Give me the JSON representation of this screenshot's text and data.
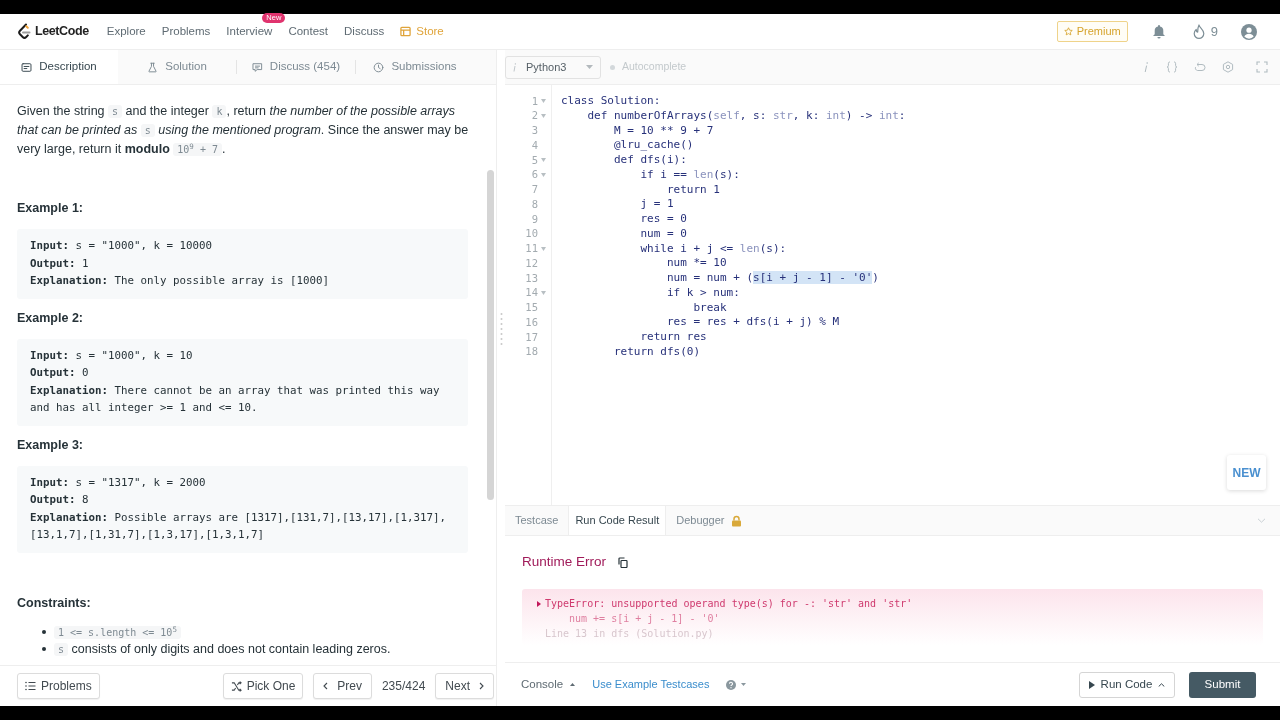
{
  "nav": {
    "logo": "LeetCode",
    "items": [
      {
        "label": "Explore",
        "kind": "link"
      },
      {
        "label": "Problems",
        "kind": "link"
      },
      {
        "label": "Interview",
        "kind": "link",
        "badge": "New"
      },
      {
        "label": "Contest",
        "kind": "link"
      },
      {
        "label": "Discuss",
        "kind": "link"
      },
      {
        "label": "Store",
        "kind": "store"
      }
    ],
    "premium": "Premium",
    "streak": "9"
  },
  "description_tabs": [
    {
      "label": "Description",
      "kind": "description",
      "selected": true
    },
    {
      "label": "Solution",
      "kind": "solution",
      "selected": false
    },
    {
      "label": "Discuss (454)",
      "kind": "discuss",
      "selected": false
    },
    {
      "label": "Submissions",
      "kind": "submissions",
      "selected": false
    }
  ],
  "editor_toolbar": {
    "language": "Python3",
    "autocomplete": {
      "label": "Autocomplete",
      "on": false
    }
  },
  "statement": [
    {
      "kind": "text",
      "text": "Given the string "
    },
    {
      "kind": "code",
      "text": "s"
    },
    {
      "kind": "text",
      "text": " and the integer "
    },
    {
      "kind": "code",
      "text": "k"
    },
    {
      "kind": "text",
      "text": ", return *the number of the possible arrays that can be printed as* "
    },
    {
      "kind": "code",
      "text": "s"
    },
    {
      "kind": "text",
      "text": " *using the mentioned program*. Since the answer may be very large, return it **modulo** "
    },
    {
      "kind": "code",
      "text": "10$^{9}$ + 7"
    },
    {
      "kind": "text",
      "text": "."
    }
  ],
  "examples": [
    {
      "title": "Example 1:",
      "lines": [
        {
          "label": "Input:",
          "value": "s = \"1000\", k = 10000"
        },
        {
          "label": "Output:",
          "value": "1"
        },
        {
          "label": "Explanation:",
          "value": "The only possible array is [1000]"
        }
      ]
    },
    {
      "title": "Example 2:",
      "lines": [
        {
          "label": "Input:",
          "value": "s = \"1000\", k = 10"
        },
        {
          "label": "Output:",
          "value": "0"
        },
        {
          "label": "Explanation:",
          "value": "There cannot be an array that was printed this way and has all integer >= 1 and <= 10."
        }
      ]
    },
    {
      "title": "Example 3:",
      "lines": [
        {
          "label": "Input:",
          "value": "s = \"1317\", k = 2000"
        },
        {
          "label": "Output:",
          "value": "8"
        },
        {
          "label": "Explanation:",
          "value": "Possible arrays are [1317],[131,7],[13,17],[1,317],[13,1,7],[1,31,7],[1,3,17],[1,3,1,7]"
        }
      ]
    }
  ],
  "constraints": {
    "title": "Constraints:",
    "items": [
      [
        {
          "kind": "code",
          "text": "1 <= s.length <= 10$^{5}$"
        }
      ],
      [
        {
          "kind": "code",
          "text": "s"
        },
        {
          "kind": "text",
          "text": " consists of only digits and does not contain leading zeros."
        }
      ]
    ]
  },
  "code_lines": [
    {
      "number": "1",
      "foldable": true,
      "tokens": [
        {
          "kind": "plain",
          "text": "class Solution:"
        }
      ]
    },
    {
      "number": "2",
      "foldable": true,
      "tokens": [
        {
          "kind": "plain",
          "text": "    def numberOfArrays("
        },
        {
          "kind": "builtin",
          "text": "self"
        },
        {
          "kind": "plain",
          "text": ", s: "
        },
        {
          "kind": "builtin",
          "text": "str"
        },
        {
          "kind": "plain",
          "text": ", k: "
        },
        {
          "kind": "builtin",
          "text": "int"
        },
        {
          "kind": "plain",
          "text": ") -> "
        },
        {
          "kind": "builtin",
          "text": "int"
        },
        {
          "kind": "plain",
          "text": ":"
        }
      ]
    },
    {
      "number": "3",
      "foldable": false,
      "tokens": [
        {
          "kind": "plain",
          "text": "        M = 10 ** 9 + 7"
        }
      ]
    },
    {
      "number": "4",
      "foldable": false,
      "tokens": [
        {
          "kind": "plain",
          "text": "        @lru_cache()"
        }
      ]
    },
    {
      "number": "5",
      "foldable": true,
      "tokens": [
        {
          "kind": "plain",
          "text": "        def dfs(i):"
        }
      ]
    },
    {
      "number": "6",
      "foldable": true,
      "tokens": [
        {
          "kind": "plain",
          "text": "            if i == "
        },
        {
          "kind": "builtin",
          "text": "len"
        },
        {
          "kind": "plain",
          "text": "(s):"
        }
      ]
    },
    {
      "number": "7",
      "foldable": false,
      "tokens": [
        {
          "kind": "plain",
          "text": "                return 1"
        }
      ]
    },
    {
      "number": "8",
      "foldable": false,
      "tokens": [
        {
          "kind": "plain",
          "text": "            j = 1"
        }
      ]
    },
    {
      "number": "9",
      "foldable": false,
      "tokens": [
        {
          "kind": "plain",
          "text": "            res = 0"
        }
      ]
    },
    {
      "number": "10",
      "foldable": false,
      "tokens": [
        {
          "kind": "plain",
          "text": "            num = 0"
        }
      ]
    },
    {
      "number": "11",
      "foldable": true,
      "tokens": [
        {
          "kind": "plain",
          "text": "            while i + j <= "
        },
        {
          "kind": "builtin",
          "text": "len"
        },
        {
          "kind": "plain",
          "text": "(s):"
        }
      ]
    },
    {
      "number": "12",
      "foldable": false,
      "tokens": [
        {
          "kind": "plain",
          "text": "                num *= 10"
        }
      ]
    },
    {
      "number": "13",
      "foldable": false,
      "tokens": [
        {
          "kind": "plain",
          "text": "                num = num + ("
        },
        {
          "kind": "selected",
          "text": "s[i + j - 1] - '0'"
        },
        {
          "kind": "plain",
          "text": ")"
        }
      ]
    },
    {
      "number": "14",
      "foldable": true,
      "tokens": [
        {
          "kind": "plain",
          "text": "                if k > num:"
        }
      ]
    },
    {
      "number": "15",
      "foldable": false,
      "tokens": [
        {
          "kind": "plain",
          "text": "                    break"
        }
      ]
    },
    {
      "number": "16",
      "foldable": false,
      "tokens": [
        {
          "kind": "plain",
          "text": "                res = res + dfs(i + j) % M"
        }
      ]
    },
    {
      "number": "17",
      "foldable": false,
      "tokens": [
        {
          "kind": "plain",
          "text": "            return res"
        }
      ]
    },
    {
      "number": "18",
      "foldable": false,
      "tokens": [
        {
          "kind": "plain",
          "text": "        return dfs(0)"
        }
      ]
    }
  ],
  "new_badge": "NEW",
  "result_tabs": [
    {
      "label": "Testcase",
      "selected": false,
      "locked": false
    },
    {
      "label": "Run Code Result",
      "selected": true,
      "locked": false
    },
    {
      "label": "Debugger",
      "selected": false,
      "locked": true
    }
  ],
  "result": {
    "title": "Runtime Error",
    "expanded": false,
    "error_lines": [
      {
        "kind": "message",
        "text": "TypeError: unsupported operand type(s) for -: 'str' and 'str'"
      },
      {
        "kind": "source",
        "text": "num += s[i + j - 1] - '0'"
      },
      {
        "kind": "location",
        "text": "Line 13 in dfs (Solution.py)"
      }
    ]
  },
  "problem_nav": {
    "problems": "Problems",
    "pick_one": "Pick One",
    "prev": "Prev",
    "position": "235/424",
    "next": "Next"
  },
  "console_bar": {
    "console": "Console",
    "example_testcases": "Use Example Testcases",
    "run_code": "Run Code",
    "submit": "Submit"
  }
}
